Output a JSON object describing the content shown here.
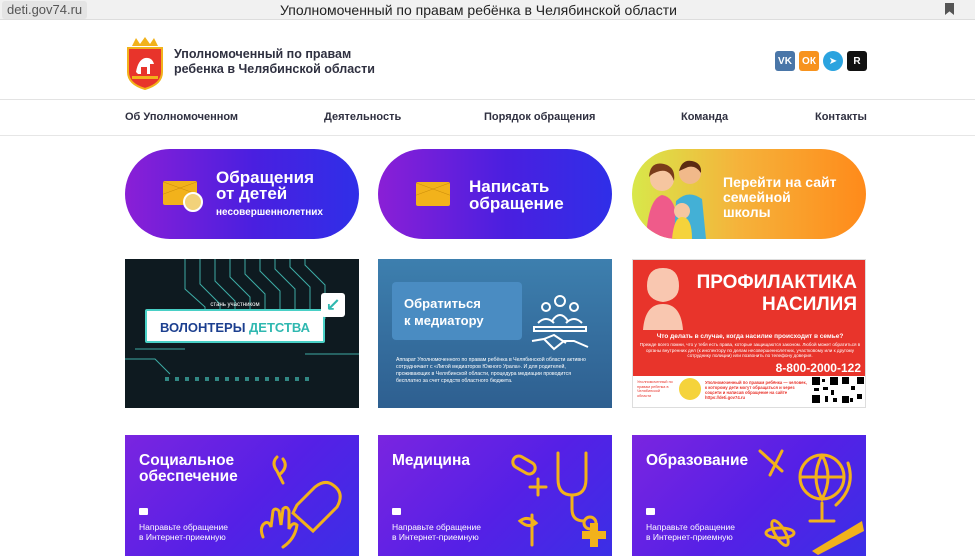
{
  "browser": {
    "url": "deti.gov74.ru",
    "title": "Уполномоченный по правам ребёнка в Челябинской области"
  },
  "header": {
    "site_name_line1": "Уполномоченный по правам",
    "site_name_line2": "ребенка в Челябинской области",
    "socials": [
      {
        "name": "vk",
        "label": "VK",
        "color": "#4a76a8"
      },
      {
        "name": "ok",
        "label": "ОК",
        "color": "#f7931e"
      },
      {
        "name": "telegram",
        "label": "➤",
        "color": "#2aa3df"
      },
      {
        "name": "rutube",
        "label": "R",
        "color": "#111111"
      }
    ]
  },
  "nav": {
    "items": [
      {
        "label": "Об Уполномоченном"
      },
      {
        "label": "Деятельность"
      },
      {
        "label": "Порядок обращения"
      },
      {
        "label": "Команда"
      },
      {
        "label": "Контакты"
      }
    ]
  },
  "pills": {
    "children_title1": "Обращения",
    "children_title2": "от детей",
    "children_sub": "несовершеннолетних",
    "write_title1": "Написать",
    "write_title2": "обращение",
    "school_title1": "Перейти на сайт",
    "school_title2": "семейной",
    "school_title3": "школы"
  },
  "cards": {
    "volunteers_small": "стань участником",
    "volunteers_word1": "ВОЛОНТЕРЫ",
    "volunteers_word2": "ДЕТСТВА",
    "mediator_title1": "Обратиться",
    "mediator_title2": "к медиатору",
    "mediator_text": "Аппарат Уполномоченного по правам ребёнка в Челябинской области активно сотрудничает с «Лигой медиаторов Южного Урала». И для родителей, проживающих в Челябинской области, процедура медиации проводится бесплатно за счет средств областного бюджета.",
    "prevention_title1": "ПРОФИЛАКТИКА",
    "prevention_title2": "НАСИЛИЯ",
    "prevention_question": "Что делать в случае, когда насилие происходит в семье?",
    "prevention_text": "Прежде всего помни, что у тебя есть права, которые защищаются законом. Любой может обратиться в органы внутренних дел (к инспектору по делам несовершеннолетних, участковому или к другому сотруднику полиции) или позвонить по телефону доверия.",
    "prevention_phone": "8-800-2000-122",
    "prevention_org": "Уполномоченный по правам ребенка в Челябинской области",
    "prevention_footer": "Уполномоченный по правам ребёнка — человек, к которому дети могут обращаться и через соцсети и написав обращение на сайте https://deti.gov74.ru"
  },
  "tiles": {
    "social_title1": "Социальное",
    "social_title2": "обеспечение",
    "medicine_title": "Медицина",
    "education_title": "Образование",
    "note1": "Направьте обращение",
    "note2": "в Интернет-приемную"
  },
  "colors": {
    "accent_purple": "#5520e6",
    "accent_yellow": "#f2b21b",
    "prevention_red": "#e8342b"
  }
}
